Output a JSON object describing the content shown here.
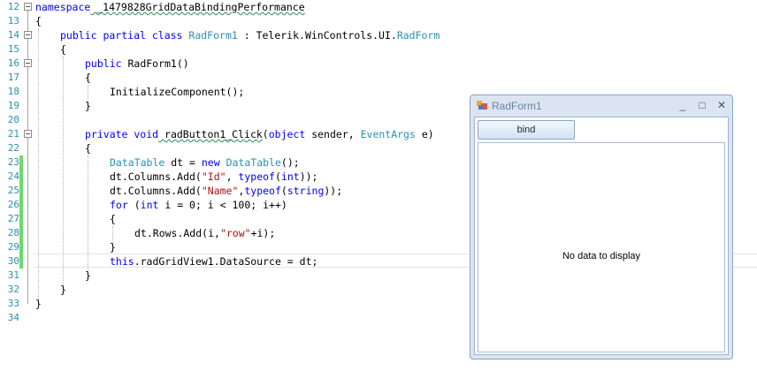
{
  "editor": {
    "line_numbers": [
      "12",
      "13",
      "14",
      "15",
      "16",
      "17",
      "18",
      "19",
      "20",
      "21",
      "22",
      "23",
      "24",
      "25",
      "26",
      "27",
      "28",
      "29",
      "30",
      "31",
      "32",
      "33",
      "34"
    ],
    "lines": {
      "l12": [
        "namespace",
        " _1479828GridDataBindingPerformance"
      ],
      "l13": [
        "{"
      ],
      "l14": [
        "public partial class",
        " RadForm1",
        " : Telerik.WinControls.UI.",
        "RadForm"
      ],
      "l15": [
        "{"
      ],
      "l16": [
        "public",
        " RadForm1()"
      ],
      "l17": [
        "{"
      ],
      "l18": [
        "InitializeComponent();"
      ],
      "l19": [
        "}"
      ],
      "l21": [
        "private void",
        " radButton1_Click",
        "(",
        "object",
        " sender, ",
        "EventArgs",
        " e)"
      ],
      "l22": [
        "{"
      ],
      "l23": [
        "DataTable",
        " dt = ",
        "new",
        " ",
        "DataTable",
        "();"
      ],
      "l24": [
        "dt.Columns.Add(",
        "\"Id\"",
        ", ",
        "typeof",
        "(",
        "int",
        "));"
      ],
      "l25": [
        "dt.Columns.Add(",
        "\"Name\"",
        ",",
        "typeof",
        "(",
        "string",
        "));"
      ],
      "l26": [
        "for",
        " (",
        "int",
        " i = 0; i < 100; i++)"
      ],
      "l27": [
        "{"
      ],
      "l28": [
        "dt.Rows.Add(i,",
        "\"row\"",
        "+i);"
      ],
      "l29": [
        "}"
      ],
      "l30": [
        "this",
        ".radGridView1.DataSource = dt;"
      ],
      "l31": [
        "}"
      ],
      "l32": [
        "}"
      ],
      "l33": [
        "}"
      ]
    }
  },
  "window": {
    "title": "RadForm1",
    "minimize_glyph": "_",
    "maximize_glyph": "□",
    "close_glyph": "✕",
    "bind_button_label": "bind",
    "grid_empty_text": "No data to display"
  },
  "colors": {
    "keyword": "#0000ff",
    "type": "#2b91af",
    "string": "#a31515",
    "line_number": "#2b91af",
    "modified_marker": "#6dd86d"
  }
}
